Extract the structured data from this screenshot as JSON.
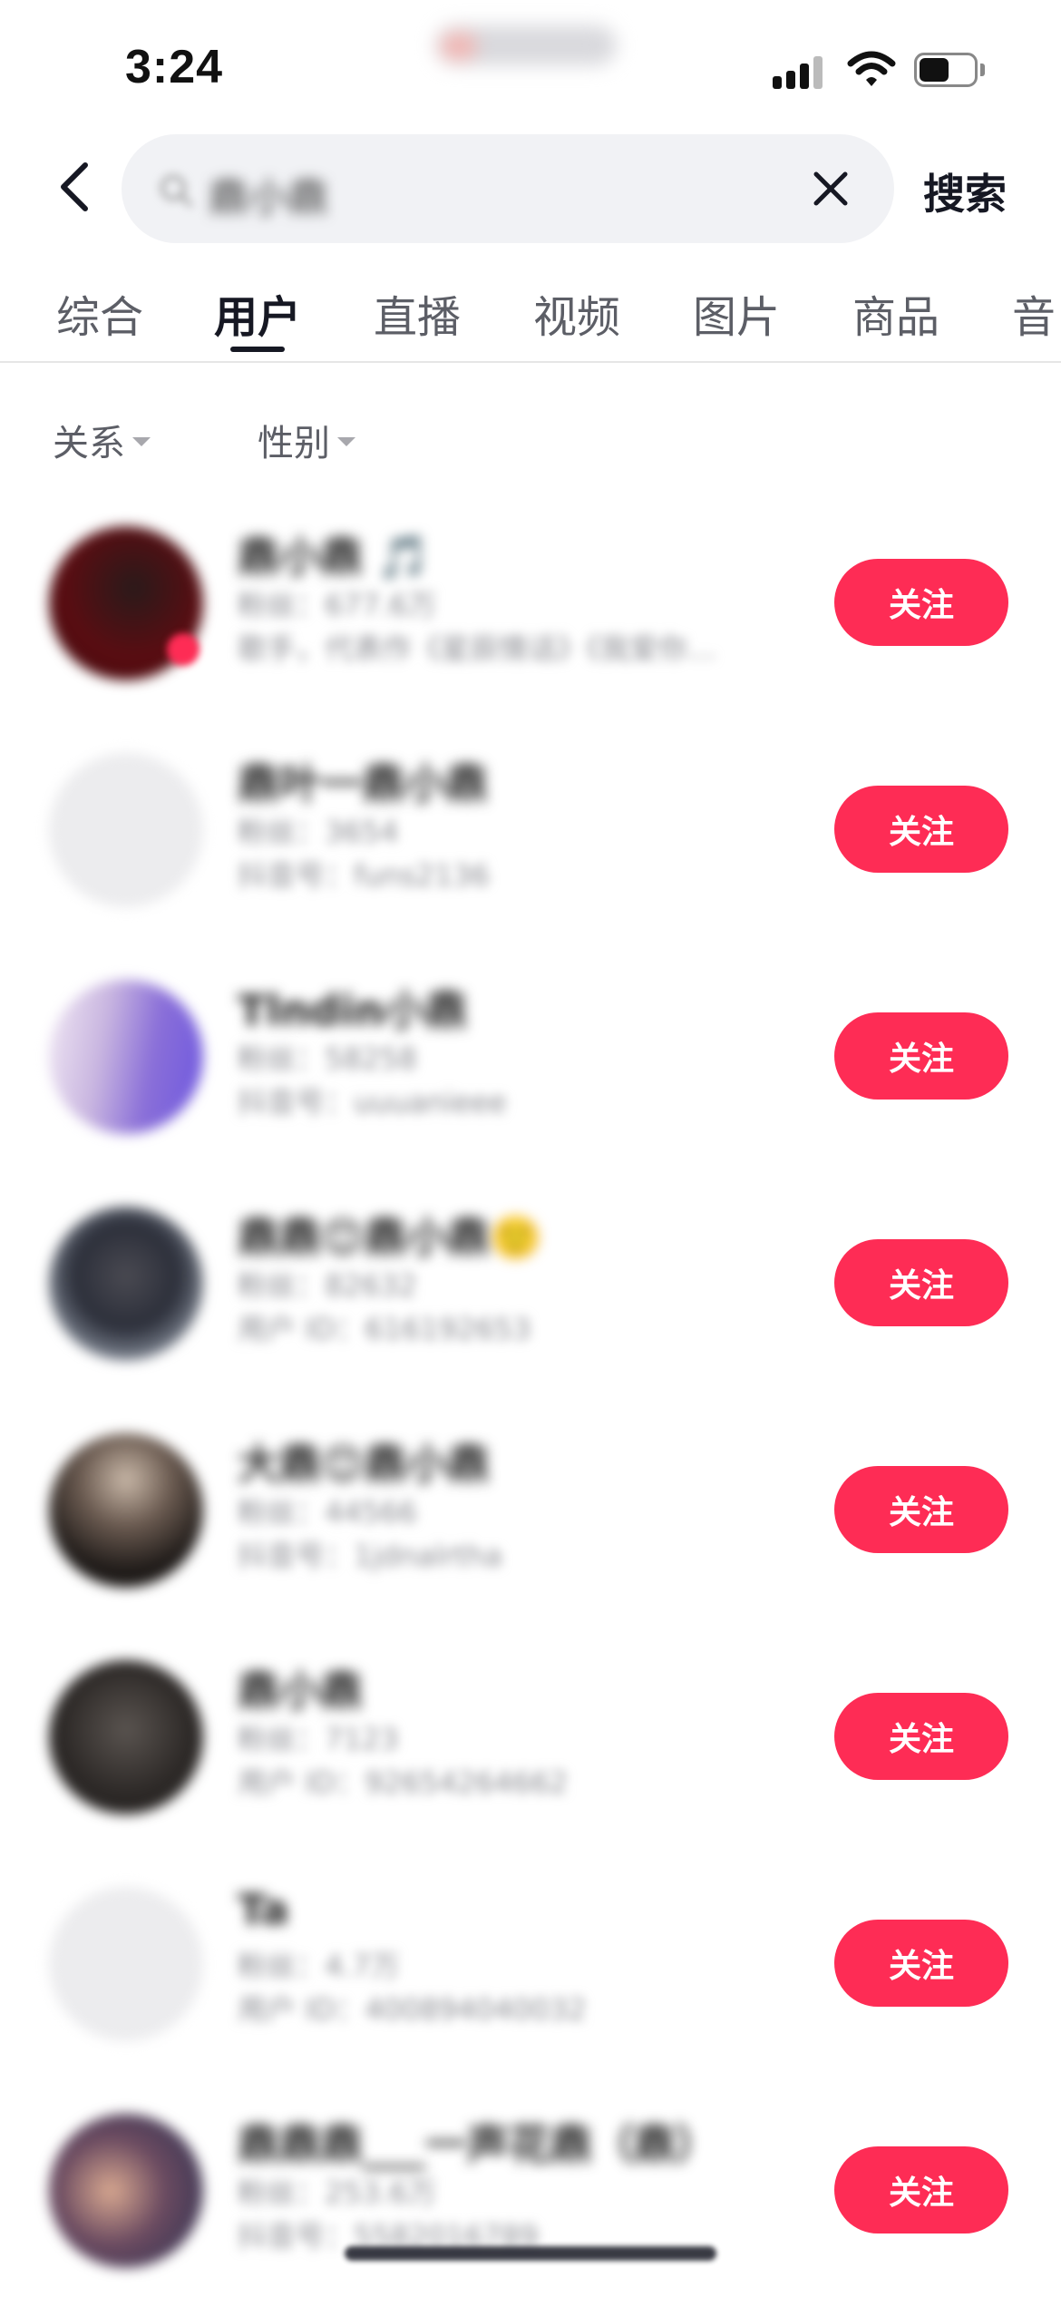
{
  "status_bar": {
    "time": "3:24"
  },
  "search": {
    "query": "鼎小鼎",
    "submit_label": "搜索"
  },
  "tabs": [
    {
      "label": "综合",
      "active": false
    },
    {
      "label": "用户",
      "active": true
    },
    {
      "label": "直播",
      "active": false
    },
    {
      "label": "视频",
      "active": false
    },
    {
      "label": "图片",
      "active": false
    },
    {
      "label": "商品",
      "active": false
    },
    {
      "label": "音",
      "active": false
    }
  ],
  "filters": [
    {
      "label": "关系"
    },
    {
      "label": "性别"
    }
  ],
  "users": [
    {
      "name": "鼎小鼎 🎵",
      "meta1": "粉丝：677.6万",
      "meta2": "歌手，代表作《星辰情话》《我爱你…",
      "follow_label": "关注",
      "avatar_color": "#5a0d12"
    },
    {
      "name": "鼎叶一鼎小鼎",
      "meta1": "粉丝：3654",
      "meta2": "抖音号：funs2136",
      "follow_label": "关注",
      "avatar_color": "#ececee"
    },
    {
      "name": "Tlndin小鼎",
      "meta1": "粉丝：58258",
      "meta2": "抖音号：uuuanieee",
      "follow_label": "关注",
      "avatar_color": "#8a6fd8"
    },
    {
      "name": "鼎鼎😊鼎小鼎🙂",
      "meta1": "粉丝：82632",
      "meta2": "用户 ID：616192653",
      "follow_label": "关注",
      "avatar_color": "#3c4050"
    },
    {
      "name": "大鼎😊鼎小鼎",
      "meta1": "粉丝：44566",
      "meta2": "抖音号：1jdnalrtha",
      "follow_label": "关注",
      "avatar_color": "#2a2523"
    },
    {
      "name": "鼎小鼎",
      "meta1": "粉丝：7123",
      "meta2": "用户 ID：92654264662",
      "follow_label": "关注",
      "avatar_color": "#2e2a28"
    },
    {
      "name": "Ta",
      "meta1": "粉丝：4.7万",
      "meta2": "用户 ID：400894040032",
      "follow_label": "关注",
      "avatar_color": "#ececee"
    },
    {
      "name": "鼎鼎鼎___一声花鼎（鼎）",
      "meta1": "粉丝：253.6万",
      "meta2": "抖音号：5582016789",
      "follow_label": "关注",
      "avatar_color": "#3a3045"
    }
  ],
  "colors": {
    "accent": "#fe2c55",
    "text_primary": "#161823",
    "text_secondary": "#8a8b91",
    "search_bg": "#f1f2f5"
  },
  "icons": [
    "back-arrow-icon",
    "search-icon",
    "close-icon",
    "signal-icon",
    "wifi-icon",
    "battery-icon",
    "caret-down-icon"
  ]
}
